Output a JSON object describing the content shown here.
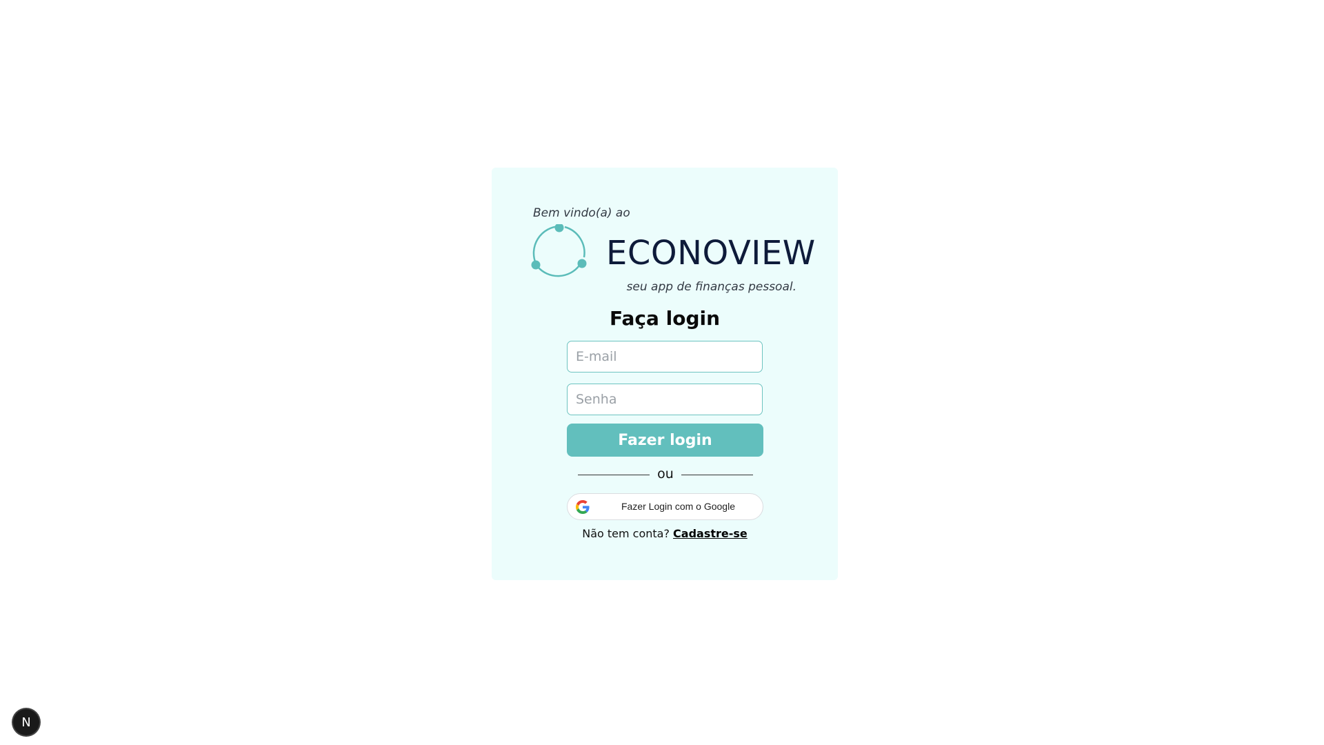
{
  "card": {
    "welcome": "Bem vindo(a) ao",
    "brand": "ECONOVIEW",
    "tagline": "seu app de finanças pessoal.",
    "title": "Faça login"
  },
  "form": {
    "email_placeholder": "E-mail",
    "email_value": "",
    "password_placeholder": "Senha",
    "password_value": "",
    "login_label": "Fazer login",
    "divider_label": "ou",
    "google_label": "Fazer Login com o Google"
  },
  "signup": {
    "prompt": "Não tem conta?",
    "link": "Cadastre-se"
  },
  "dev_badge": {
    "label": "N",
    "icon": "nextjs-logo-icon"
  },
  "colors": {
    "card_background": "#ecfdfc",
    "accent": "#62bfbd",
    "brand_text": "#0e1b3a"
  }
}
